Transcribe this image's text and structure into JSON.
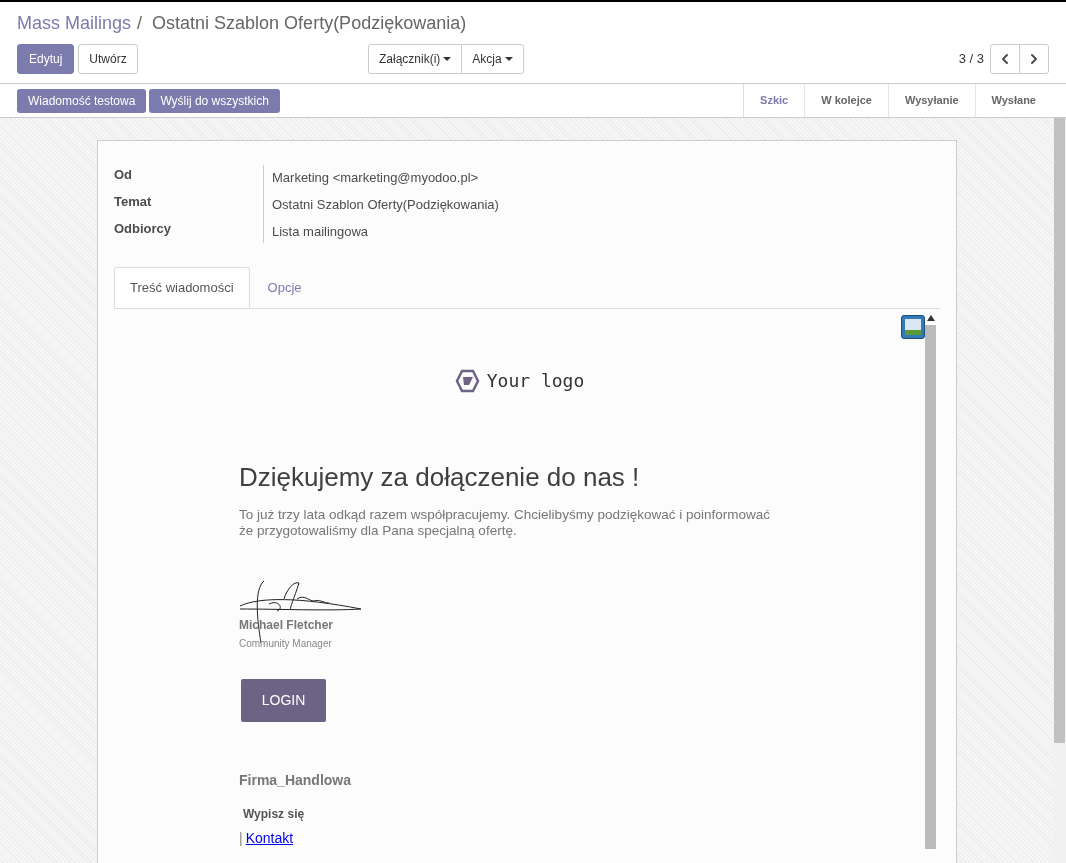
{
  "breadcrumb": {
    "parent": "Mass Mailings",
    "separator": "/",
    "current": "Ostatni Szablon Oferty(Podziękowania)"
  },
  "buttons": [
    {
      "label": "Edytuj",
      "kind": "primary"
    },
    {
      "label": "Utwórz",
      "kind": "secondary"
    }
  ],
  "dropdowns": [
    {
      "label": "Załącznik(i)"
    },
    {
      "label": "Akcja"
    }
  ],
  "pager": {
    "counter": "3 / 3"
  },
  "actions": [
    {
      "label": "Wiadomość testowa"
    },
    {
      "label": "Wyślij do wszystkich"
    }
  ],
  "stages": [
    {
      "label": "Szkic",
      "selected": true
    },
    {
      "label": "W kolejce",
      "selected": false
    },
    {
      "label": "Wysyłanie",
      "selected": false
    },
    {
      "label": "Wysłane",
      "selected": false
    }
  ],
  "fields": [
    {
      "label": "Od",
      "value": "Marketing <marketing@myodoo.pl>"
    },
    {
      "label": "Temat",
      "value": "Ostatni Szablon Oferty(Podziękowania)"
    },
    {
      "label": "Odbiorcy",
      "value": "Lista mailingowa"
    }
  ],
  "tabs": [
    {
      "label": "Treść wiadomości",
      "selected": true
    },
    {
      "label": "Opcje",
      "selected": false
    }
  ],
  "email": {
    "logo_text": "Your logo",
    "heading": "Dziękujemy za dołączenie do nas !",
    "body": "To już trzy lata odkąd razem współpracujemy. Chcielibyśmy podziękować i poinformować że przygotowaliśmy dla Pana specjalną ofertę.",
    "signer_name": "Michael Fletcher",
    "signer_role": "Community Manager",
    "cta": "LOGIN",
    "company": "Firma_Handlowa",
    "unsubscribe": "Wypisz się",
    "separator": "|",
    "contact_link": "Kontakt"
  }
}
